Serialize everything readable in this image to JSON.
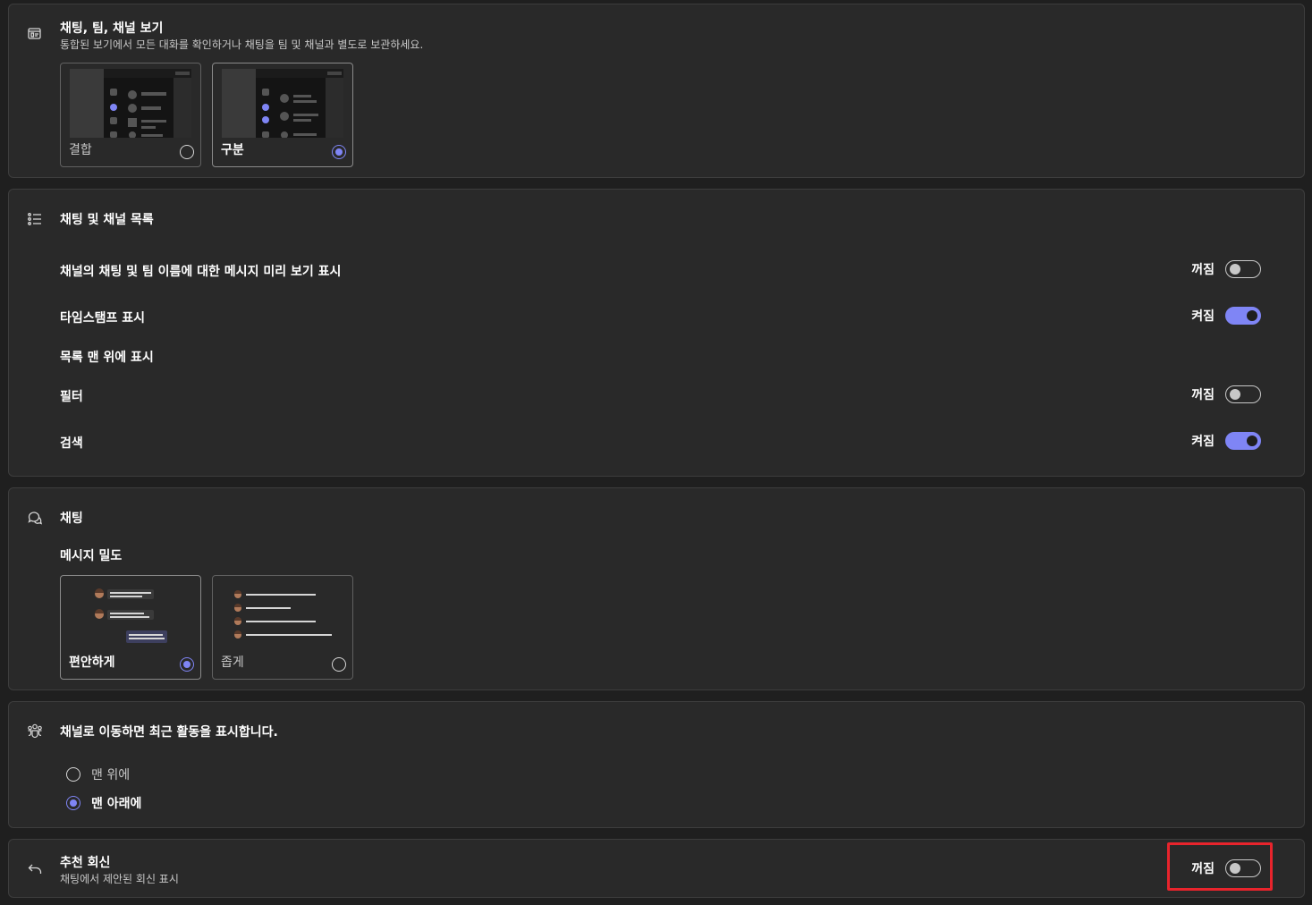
{
  "view_section": {
    "title": "채팅, 팀, 채널 보기",
    "subtitle": "통합된 보기에서 모든 대화를 확인하거나 채팅을 팀 및 채널과 별도로 보관하세요.",
    "options": [
      {
        "label": "결합",
        "selected": false
      },
      {
        "label": "구분",
        "selected": true
      }
    ]
  },
  "list_section": {
    "title": "채팅 및 채널 목록",
    "rows": [
      {
        "label": "채널의 채팅 및 팀 이름에 대한 메시지 미리 보기 표시",
        "state": "꺼짐",
        "on": false
      },
      {
        "label": "타임스탬프 표시",
        "state": "켜짐",
        "on": true
      }
    ],
    "top_heading": "목록 맨 위에 표시",
    "top_rows": [
      {
        "label": "필터",
        "state": "꺼짐",
        "on": false
      },
      {
        "label": "검색",
        "state": "켜짐",
        "on": true
      }
    ]
  },
  "chat_section": {
    "title": "채팅",
    "density_label": "메시지 밀도",
    "options": [
      {
        "label": "편안하게",
        "selected": true
      },
      {
        "label": "좁게",
        "selected": false
      }
    ]
  },
  "channel_section": {
    "title": "채널로 이동하면 최근 활동을 표시합니다.",
    "options": [
      {
        "label": "맨 위에",
        "selected": false
      },
      {
        "label": "맨 아래에",
        "selected": true
      }
    ]
  },
  "reply_section": {
    "title": "추천 회신",
    "subtitle": "채팅에서 제안된 회신 표시",
    "state": "꺼짐",
    "on": false
  },
  "colors": {
    "accent": "#7f85f5",
    "highlight": "#e8242c"
  }
}
